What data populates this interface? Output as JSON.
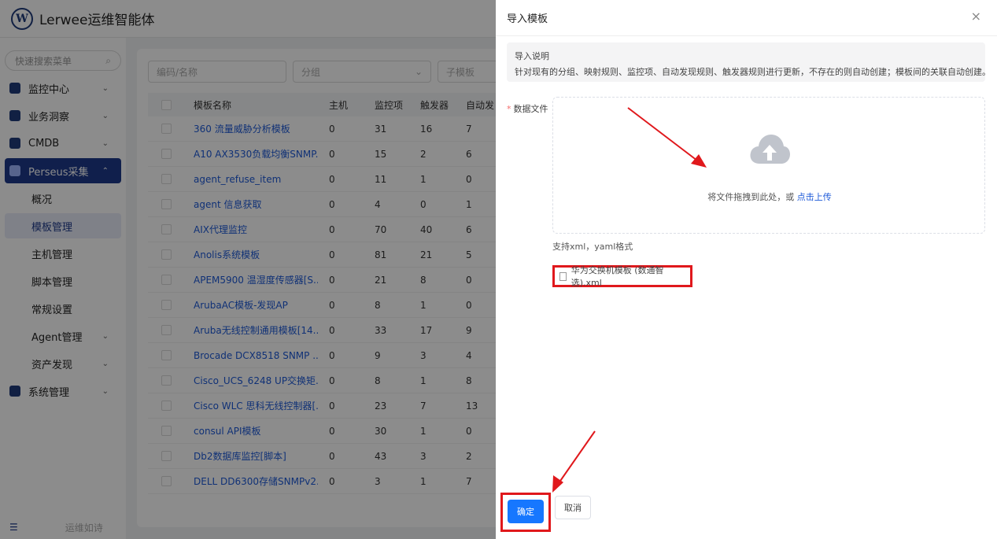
{
  "app": {
    "logo_letter": "W",
    "brand": "Lerwee运维智能体"
  },
  "sidebar": {
    "search_placeholder": "快速搜索菜单",
    "items": [
      {
        "label": "监控中心",
        "icon": "monitor-icon",
        "expandable": true
      },
      {
        "label": "业务洞察",
        "icon": "insight-icon",
        "expandable": true
      },
      {
        "label": "CMDB",
        "icon": "cmdb-icon",
        "expandable": true
      },
      {
        "label": "Perseus采集",
        "icon": "perseus-icon",
        "expandable": true,
        "active": true
      }
    ],
    "subitems": [
      {
        "label": "概况"
      },
      {
        "label": "模板管理",
        "selected": true
      },
      {
        "label": "主机管理"
      },
      {
        "label": "脚本管理"
      },
      {
        "label": "常规设置"
      },
      {
        "label": "Agent管理",
        "expandable": true
      },
      {
        "label": "资产发现",
        "expandable": true
      }
    ],
    "system": {
      "label": "系统管理",
      "icon": "gear-icon"
    },
    "footer_slogan": "运维如诗"
  },
  "filters": {
    "code_name_placeholder": "编码/名称",
    "group_placeholder": "分组",
    "subtemplate_placeholder": "子模板"
  },
  "table": {
    "headers": [
      "模板名称",
      "主机",
      "监控项",
      "触发器",
      "自动发"
    ],
    "rows": [
      [
        "360 流量威胁分析模板",
        "0",
        "31",
        "16",
        "7"
      ],
      [
        "A10 AX3530负载均衡SNMP...",
        "0",
        "15",
        "2",
        "6"
      ],
      [
        "agent_refuse_item",
        "0",
        "11",
        "1",
        "0"
      ],
      [
        "agent 信息获取",
        "0",
        "4",
        "0",
        "1"
      ],
      [
        "AIX代理监控",
        "0",
        "70",
        "40",
        "6"
      ],
      [
        "Anolis系统模板",
        "0",
        "81",
        "21",
        "5"
      ],
      [
        "APEM5900 温湿度传感器[S...",
        "0",
        "21",
        "8",
        "0"
      ],
      [
        "ArubaAC模板-发现AP",
        "0",
        "8",
        "1",
        "0"
      ],
      [
        "Aruba无线控制通用模板[14...",
        "0",
        "33",
        "17",
        "9"
      ],
      [
        "Brocade DCX8518 SNMP ...",
        "0",
        "9",
        "3",
        "4"
      ],
      [
        "Cisco_UCS_6248 UP交换矩...",
        "0",
        "8",
        "1",
        "8"
      ],
      [
        "Cisco WLC 思科无线控制器[...",
        "0",
        "23",
        "7",
        "13"
      ],
      [
        "consul API模板",
        "0",
        "30",
        "1",
        "0"
      ],
      [
        "Db2数据库监控[脚本]",
        "0",
        "43",
        "3",
        "2"
      ],
      [
        "DELL DD6300存储SNMPv2...",
        "0",
        "3",
        "1",
        "7"
      ]
    ]
  },
  "drawer": {
    "title": "导入模板",
    "notice_title": "导入说明",
    "notice_text": "针对现有的分组、映射规则、监控项、自动发现规则、触发器规则进行更新，不存在的则自动创建；模板间的关联自动创建。",
    "field_label": "数据文件",
    "required_mark": "*",
    "upload_text": "将文件拖拽到此处，或",
    "upload_link": "点击上传",
    "tip": "支持xml，yaml格式",
    "file_name": "华为交换机模板 (数通智选).xml",
    "confirm_label": "确定",
    "cancel_label": "取消",
    "close_symbol": "×"
  },
  "colors": {
    "primary": "#1677ff",
    "nav_active": "#1e3a8a",
    "annotation": "#e0181c",
    "link": "#1e5ad8"
  }
}
